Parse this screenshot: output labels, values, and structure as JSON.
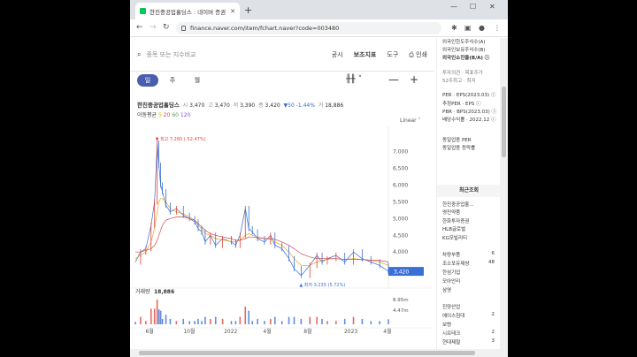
{
  "browser": {
    "tab_title": "한진중공업홀딩스 : 네이버 증권",
    "url": "finance.naver.com/item/fchart.naver?code=003480"
  },
  "topnav": {
    "search_placeholder": "종목 또는 지수비교",
    "links": [
      "공시",
      "보조지표",
      "도구",
      "인쇄"
    ]
  },
  "periods": [
    "일",
    "주",
    "월"
  ],
  "stock": {
    "name": "한진중공업홀딩스",
    "open_label": "시",
    "open": "3,470",
    "high_label": "고",
    "high": "3,470",
    "low_label": "저",
    "low": "3,390",
    "close_label": "종",
    "close": "3,420",
    "change": "▼50",
    "change_pct": "-1.44%",
    "volume_label": "거",
    "volume": "18,886"
  },
  "ma_line": {
    "label": "이동평균",
    "periods": [
      "5",
      "20",
      "60",
      "120"
    ],
    "colors": [
      "#e8a317",
      "#d4454f",
      "#5aa05a",
      "#7a5fd0"
    ]
  },
  "scale_label": "Linear",
  "chart_data": {
    "type": "line",
    "title": "",
    "xlabel": "",
    "ylabel": "",
    "x_ticks": [
      "6월",
      "10월",
      "2022",
      "4월",
      "8월",
      "2023",
      "4월"
    ],
    "y_ticks": [
      7000,
      6500,
      6000,
      5500,
      5000,
      4500,
      4000
    ],
    "ylim": [
      3000,
      7600
    ],
    "max_label": "▼ 최고 7,260 (-52.47%)",
    "min_label": "▲ 최저 3,235 (5.72%)",
    "last_price_label": "3,420",
    "x": [
      0,
      6,
      12,
      18,
      22,
      25,
      27,
      29,
      31,
      35,
      40,
      47,
      55,
      62,
      68,
      72,
      76,
      80,
      86,
      92,
      100,
      110,
      115,
      120,
      126,
      130,
      134,
      140,
      148,
      155,
      160,
      168,
      176,
      182,
      190,
      200,
      208,
      214,
      220,
      230,
      240,
      250,
      260,
      270,
      280,
      290
    ],
    "series": [
      {
        "values": [
          3700,
          4000,
          4100,
          4800,
          5500,
          7260,
          6600,
          6000,
          5800,
          5400,
          5200,
          5300,
          5100,
          5000,
          4900,
          4700,
          4600,
          4300,
          4500,
          4200,
          4400,
          4300,
          4200,
          4500,
          5300,
          4700,
          4600,
          4400,
          4300,
          4500,
          4200,
          4100,
          3800,
          3500,
          3300,
          3600,
          3900,
          3700,
          3800,
          3900,
          3700,
          4000,
          3800,
          3700,
          3600,
          3420
        ]
      },
      {
        "values": [
          3800,
          3900,
          4000,
          4300,
          4700,
          5200,
          5500,
          5600,
          5600,
          5500,
          5300,
          5200,
          5150,
          5050,
          4950,
          4800,
          4700,
          4550,
          4500,
          4400,
          4350,
          4320,
          4300,
          4350,
          4500,
          4550,
          4500,
          4450,
          4400,
          4380,
          4300,
          4200,
          4000,
          3800,
          3600,
          3600,
          3700,
          3750,
          3780,
          3800,
          3780,
          3800,
          3780,
          3750,
          3700,
          3600
        ]
      },
      {
        "values": [
          4000,
          4000,
          4050,
          4100,
          4200,
          4350,
          4500,
          4650,
          4800,
          4950,
          5000,
          5050,
          5050,
          5000,
          4950,
          4850,
          4750,
          4650,
          4550,
          4500,
          4450,
          4400,
          4350,
          4350,
          4400,
          4450,
          4450,
          4430,
          4400,
          4400,
          4380,
          4300,
          4200,
          4100,
          3950,
          3850,
          3800,
          3800,
          3800,
          3800,
          3780,
          3780,
          3770,
          3760,
          3750,
          3700
        ]
      }
    ],
    "volume": {
      "label": "거래량",
      "value": "18,886",
      "ticks": [
        "8.95m",
        "4.47m"
      ]
    }
  }
}
